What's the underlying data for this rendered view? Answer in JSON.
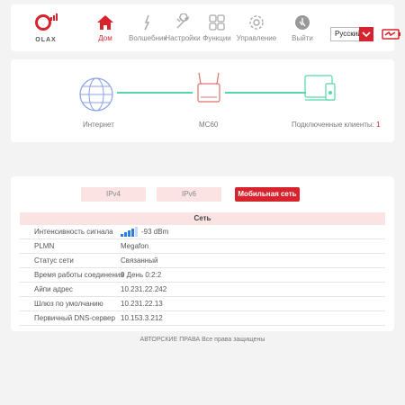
{
  "brand": {
    "name": "OLAX",
    "accent": "#d6232d"
  },
  "nav": {
    "home": "Дом",
    "wizard": "Волшебник",
    "settings": "Настройки",
    "functions": "Функции",
    "management": "Управление",
    "logout": "Выйти"
  },
  "language": {
    "selected": "Русский"
  },
  "diagram": {
    "internet_label": "Интернет",
    "device_label": "MC60",
    "clients_label": "Подключенные клиенты:",
    "clients_count": "1"
  },
  "tabs": {
    "ipv4": "IPv4",
    "ipv6": "IPv6",
    "mobile": "Мобильная сеть"
  },
  "table": {
    "header": "Сеть",
    "rows": [
      {
        "key": "Интенсивность сигнала",
        "value": "-93 dBm",
        "signal_bars": 4,
        "signal_total": 5
      },
      {
        "key": "PLMN",
        "value": "Megafon"
      },
      {
        "key": "Статус сети",
        "value": "Связанный"
      },
      {
        "key": "Время работы соединения",
        "value": "0 День 0:2:2"
      },
      {
        "key": "Айпи адрес",
        "value": "10.231.22.242"
      },
      {
        "key": "Шлюз по умолчанию",
        "value": "10.231.22.13"
      },
      {
        "key": "Первичный DNS-сервер",
        "value": "10.153.3.212"
      }
    ]
  },
  "footer": {
    "copyright": "АВТОРСКИЕ ПРАВА Все права защищены"
  }
}
